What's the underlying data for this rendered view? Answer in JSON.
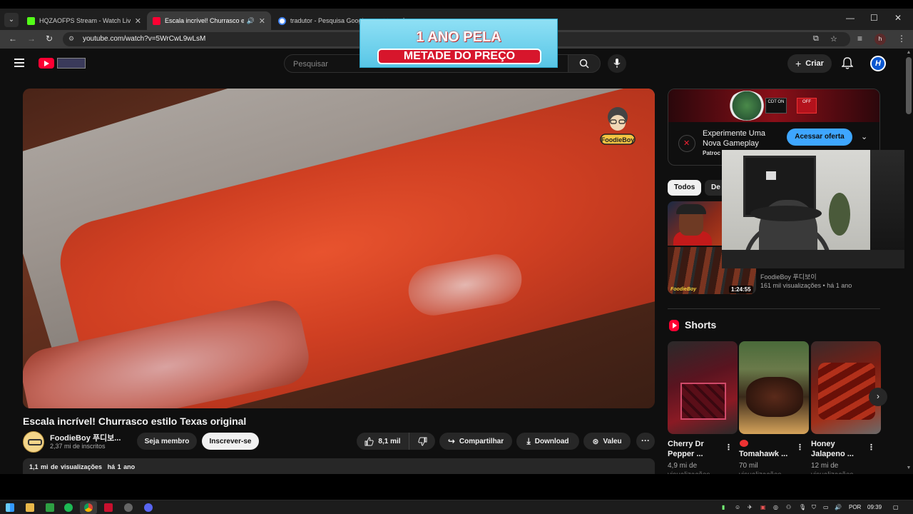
{
  "browser": {
    "tabs": [
      {
        "title": "HQZAOFPS Stream - Watch Live",
        "favicon_color": "#53fc18",
        "active": false
      },
      {
        "title": "Escala incrível! Churrasco estilo Texas original",
        "favicon_color": "#ff0033",
        "active": true
      },
      {
        "title": "tradutor - Pesquisa Google",
        "favicon_color": "#4285f4",
        "active": false
      }
    ],
    "url": "youtube.com/watch?v=5WrCwL9wLsM",
    "profile_initial": "h"
  },
  "promo_overlay": {
    "line1": "1 ANO PELA",
    "line2": "METADE DO PREÇO"
  },
  "header": {
    "search_placeholder": "Pesquisar",
    "create_label": "Criar",
    "avatar_letter": "H"
  },
  "video": {
    "title": "Escala incrível! Churrasco estilo Texas original",
    "watermark": "FoodieBoy",
    "channel_name": "FoodieBoy 푸디보...",
    "subscribers": "2,37 mi de inscritos",
    "member_label": "Seja membro",
    "subscribe_label": "Inscrever-se",
    "likes": "8,1 mil",
    "share_label": "Compartilhar",
    "download_label": "Download",
    "thanks_label": "Valeu",
    "more_label": "···",
    "views": "1,1 mi de visualizações",
    "age": "há 1 ano"
  },
  "ad": {
    "title": "Experimente Uma Nova Gameplay",
    "sponsored": "Patroc",
    "cta": "Acessar oferta",
    "tag1": "CDT ON",
    "tag2": "OFF"
  },
  "chips": [
    {
      "label": "Todos",
      "active": true
    },
    {
      "label": "De",
      "active": false
    }
  ],
  "recommended": [
    {
      "channel": "FoodieBoy 푸디보이",
      "meta": "161 mil visualizações • há 1 ano",
      "duration": "1:24:55",
      "watermark": "FoodieBoy"
    }
  ],
  "shorts": {
    "section_title": "Shorts",
    "items": [
      {
        "title": "Cherry Dr Pepper ...",
        "views": "4,9 mi de",
        "views2": "visualizações"
      },
      {
        "title": "Tomahawk ...",
        "views": "70 mil",
        "views2": "visualizações"
      },
      {
        "title": "Honey Jalapeno ...",
        "views": "12 mi de",
        "views2": "visualizações"
      }
    ]
  },
  "taskbar": {
    "language": "POR",
    "time": "09:39"
  },
  "colors": {
    "yt_red": "#ff0033",
    "cta_blue": "#3ea6ff",
    "background": "#0f0f0f"
  }
}
